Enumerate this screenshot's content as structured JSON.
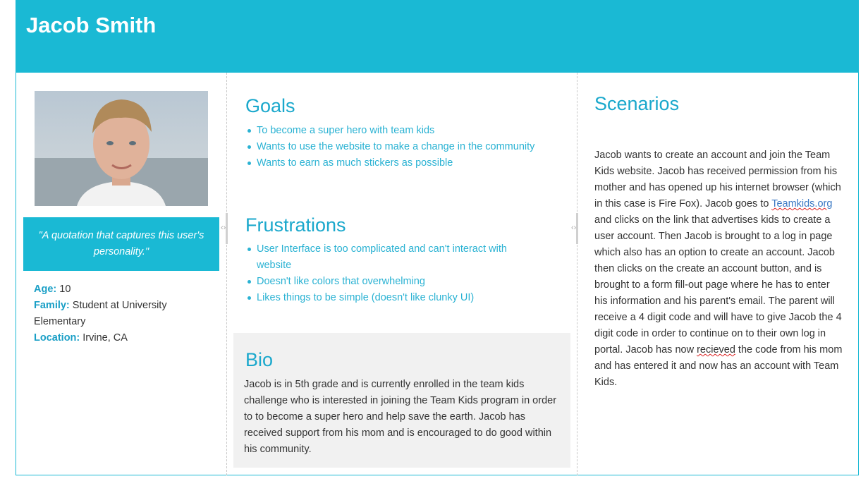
{
  "persona": {
    "name": "Jacob Smith",
    "quote": "\"A quotation that captures this user's personality.\"",
    "facts": [
      {
        "label": "Age:",
        "value": "10"
      },
      {
        "label": "Family:",
        "value": "Student at University Elementary"
      },
      {
        "label": "Location:",
        "value": "Irvine, CA"
      }
    ]
  },
  "goals": {
    "title": "Goals",
    "items": [
      "To become a super hero with team kids",
      "Wants to use the website to make a change in the community",
      "Wants to earn as much stickers as possible"
    ]
  },
  "frustrations": {
    "title": "Frustrations",
    "items": [
      "User Interface is too complicated and can't interact with website",
      "Doesn't like colors that overwhelming",
      "Likes things to be simple (doesn't like clunky UI)"
    ]
  },
  "bio": {
    "title": "Bio",
    "text": "Jacob is in 5th grade and is currently enrolled in the team kids challenge who is interested in joining the Team Kids program in order to to become a super hero and help save the earth. Jacob has received support from his mom and is encouraged to do good within his community."
  },
  "scenarios": {
    "title": "Scenarios",
    "text_before_link": "Jacob wants to create an account and join the Team Kids website. Jacob has received permission from his mother and has opened up his internet browser (which in this case is Fire Fox). Jacob goes to ",
    "link_text": "Teamkids.org",
    "text_mid": " and clicks on the link that advertises kids to create a user account. Then Jacob is brought to a log in page which also has an option to create an account. Jacob then clicks on the create an account button, and is brought to a form fill-out page where he has to enter his information and his parent's email. The parent will receive a 4 digit code and will have to give Jacob the 4 digit code in order to continue on to their own log in portal. Jacob has now ",
    "misspelled": "recieved",
    "text_after": " the code from his mom and has entered it and now has an account with Team Kids."
  },
  "colors": {
    "accent": "#1ab9d4",
    "heading": "#1aa8cc",
    "link": "#3a78c3"
  },
  "icons": [
    "resize-handle-icon"
  ]
}
